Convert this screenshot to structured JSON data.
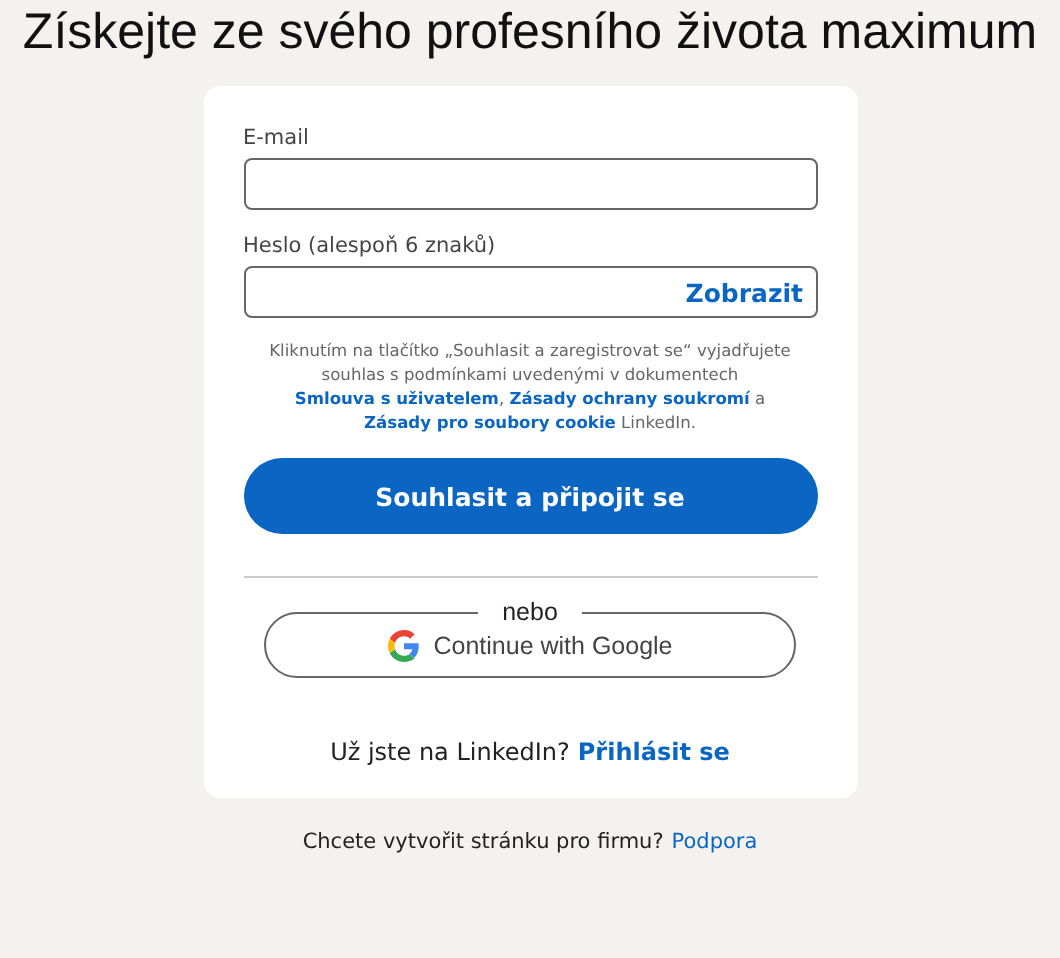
{
  "heading": "Získejte ze svého profesního života maximum",
  "form": {
    "email_label": "E-mail",
    "password_label": "Heslo (alespoň 6 znaků)",
    "show_password": "Zobrazit",
    "legal": [
      {
        "kind": "text",
        "text": "Kliknutím na tlačítko „Souhlasit a zaregistrovat se“ vyjadřujete souhlas s podmínkami uvedenými v dokumentech "
      },
      {
        "kind": "link",
        "text": "Smlouva s uživatelem"
      },
      {
        "kind": "text",
        "text": ", "
      },
      {
        "kind": "link",
        "text": "Zásady ochrany soukromí"
      },
      {
        "kind": "text",
        "text": " a "
      },
      {
        "kind": "link",
        "text": "Zásady pro soubory cookie"
      },
      {
        "kind": "text",
        "text": " LinkedIn."
      }
    ],
    "submit": "Souhlasit a připojit se",
    "divider_text": "nebo",
    "google_button": "Continue with Google",
    "signin_prompt": "Už jste na LinkedIn?",
    "signin_link": "Přihlásit se"
  },
  "footer": {
    "prompt": "Chcete vytvořit stránku pro firmu?",
    "link": "Podpora"
  }
}
